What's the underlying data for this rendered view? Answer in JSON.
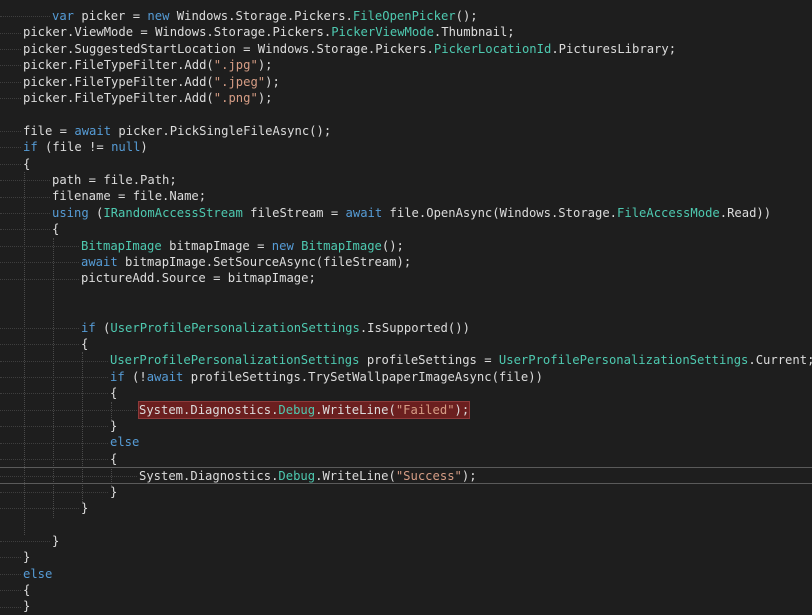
{
  "lines": [
    [
      [
        "kw",
        "var "
      ],
      [
        "pl",
        "picker "
      ],
      [
        "pl",
        "= "
      ],
      [
        "kw",
        "new "
      ],
      [
        "pl",
        "Windows.Storage.Pickers."
      ],
      [
        "ty",
        "FileOpenPicker"
      ],
      [
        "pl",
        "();"
      ]
    ],
    [
      [
        "pl",
        "picker.ViewMode = Windows.Storage.Pickers."
      ],
      [
        "ty",
        "PickerViewMode"
      ],
      [
        "pl",
        ".Thumbnail;"
      ]
    ],
    [
      [
        "pl",
        "picker.SuggestedStartLocation = Windows.Storage.Pickers."
      ],
      [
        "ty",
        "PickerLocationId"
      ],
      [
        "pl",
        ".PicturesLibrary;"
      ]
    ],
    [
      [
        "pl",
        "picker.FileTypeFilter.Add("
      ],
      [
        "str",
        "\".jpg\""
      ],
      [
        "pl",
        ");"
      ]
    ],
    [
      [
        "pl",
        "picker.FileTypeFilter.Add("
      ],
      [
        "str",
        "\".jpeg\""
      ],
      [
        "pl",
        ");"
      ]
    ],
    [
      [
        "pl",
        "picker.FileTypeFilter.Add("
      ],
      [
        "str",
        "\".png\""
      ],
      [
        "pl",
        ");"
      ]
    ],
    [],
    [
      [
        "pl",
        "file = "
      ],
      [
        "kw",
        "await "
      ],
      [
        "pl",
        "picker.PickSingleFileAsync();"
      ]
    ],
    [
      [
        "kw",
        "if "
      ],
      [
        "pl",
        "(file != "
      ],
      [
        "kw",
        "null"
      ],
      [
        "pl",
        ")"
      ]
    ],
    [
      [
        "pl",
        "{"
      ]
    ],
    [
      [
        "pl",
        "path = file.Path;"
      ]
    ],
    [
      [
        "pl",
        "filename = file.Name;"
      ]
    ],
    [
      [
        "kw",
        "using "
      ],
      [
        "pl",
        "("
      ],
      [
        "ty",
        "IRandomAccessStream "
      ],
      [
        "pl",
        "fileStream = "
      ],
      [
        "kw",
        "await "
      ],
      [
        "pl",
        "file.OpenAsync(Windows.Storage."
      ],
      [
        "ty",
        "FileAccessMode"
      ],
      [
        "pl",
        ".Read))"
      ]
    ],
    [
      [
        "pl",
        "{"
      ]
    ],
    [
      [
        "ty",
        "BitmapImage "
      ],
      [
        "pl",
        "bitmapImage = "
      ],
      [
        "kw",
        "new "
      ],
      [
        "ty",
        "BitmapImage"
      ],
      [
        "pl",
        "();"
      ]
    ],
    [
      [
        "kw",
        "await "
      ],
      [
        "pl",
        "bitmapImage.SetSourceAsync(fileStream);"
      ]
    ],
    [
      [
        "pl",
        "pictureAdd.Source = bitmapImage;"
      ]
    ],
    [],
    [],
    [
      [
        "kw",
        "if "
      ],
      [
        "pl",
        "("
      ],
      [
        "ty",
        "UserProfilePersonalizationSettings"
      ],
      [
        "pl",
        ".IsSupported())"
      ]
    ],
    [
      [
        "pl",
        "{"
      ]
    ],
    [
      [
        "ty",
        "UserProfilePersonalizationSettings "
      ],
      [
        "pl",
        "profileSettings = "
      ],
      [
        "ty",
        "UserProfilePersonalizationSettings"
      ],
      [
        "pl",
        ".Current;"
      ]
    ],
    [
      [
        "kw",
        "if "
      ],
      [
        "pl",
        "(!"
      ],
      [
        "kw",
        "await "
      ],
      [
        "pl",
        "profileSettings.TrySetWallpaperImageAsync(file))"
      ]
    ],
    [
      [
        "pl",
        "{"
      ]
    ],
    [
      [
        "pl",
        "System.Diagnostics."
      ],
      [
        "ty",
        "Debug"
      ],
      [
        "pl",
        ".WriteLine("
      ],
      [
        "str",
        "\"Failed\""
      ],
      [
        "pl",
        ");"
      ]
    ],
    [
      [
        "pl",
        "}"
      ]
    ],
    [
      [
        "kw",
        "else"
      ]
    ],
    [
      [
        "pl",
        "{"
      ]
    ],
    [
      [
        "pl",
        "System.Diagnostics."
      ],
      [
        "ty",
        "Debug"
      ],
      [
        "pl",
        ".WriteLine("
      ],
      [
        "str",
        "\"Success\""
      ],
      [
        "pl",
        ");"
      ]
    ],
    [
      [
        "pl",
        "}"
      ]
    ],
    [
      [
        "pl",
        "}"
      ]
    ],
    [],
    [
      [
        "pl",
        "}"
      ]
    ],
    [
      [
        "pl",
        "}"
      ]
    ],
    [
      [
        "kw",
        "else"
      ]
    ],
    [
      [
        "pl",
        "{"
      ]
    ],
    [
      [
        "pl",
        "}"
      ]
    ]
  ],
  "highlighted_line": 24,
  "current_line": 28,
  "colors": {
    "background": "#1e1e1e",
    "keyword": "#569cd6",
    "type": "#4ec9b0",
    "string": "#d69d85",
    "text": "#dcdcdc",
    "highlight": "#6b1f1f"
  }
}
